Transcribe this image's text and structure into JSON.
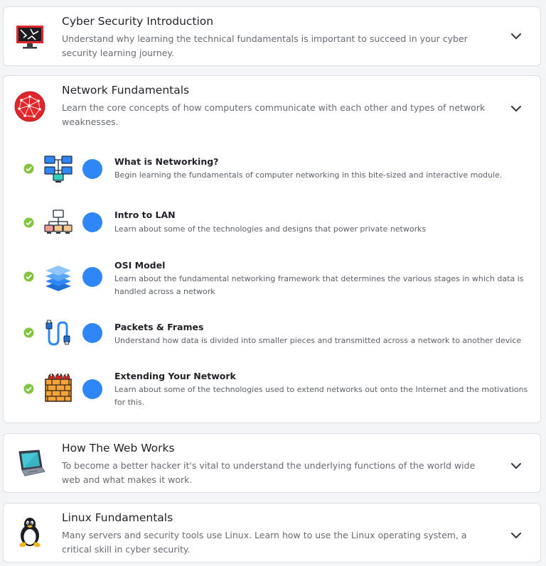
{
  "modules": [
    {
      "title": "Cyber Security Introduction",
      "description": "Understand why learning the technical fundamentals is important to succeed in your cyber security learning journey.",
      "icon": "monitor-hacked-icon",
      "expanded": false
    },
    {
      "title": "Network Fundamentals",
      "description": "Learn the core concepts of how computers communicate with each other and types of network weaknesses.",
      "icon": "network-globe-icon",
      "expanded": true,
      "rooms": [
        {
          "title": "What is Networking?",
          "description": "Begin learning the fundamentals of computer networking in this bite-sized and interactive module.",
          "icon": "networked-computers-icon",
          "completed": true
        },
        {
          "title": "Intro to LAN",
          "description": "Learn about some of the technologies and designs that power private networks",
          "icon": "lan-icon",
          "completed": true
        },
        {
          "title": "OSI Model",
          "description": "Learn about the fundamental networking framework that determines the various stages in which data is handled across a network",
          "icon": "layers-icon",
          "completed": true
        },
        {
          "title": "Packets & Frames",
          "description": "Understand how data is divided into smaller pieces and transmitted across a network to another device",
          "icon": "ethernet-cable-icon",
          "completed": true
        },
        {
          "title": "Extending Your Network",
          "description": "Learn about some of the technologies used to extend networks out onto the Internet and the motivations for this.",
          "icon": "firewall-icon",
          "completed": true
        }
      ]
    },
    {
      "title": "How The Web Works",
      "description": "To become a better hacker it's vital to understand the underlying functions of the world wide web and what makes it work.",
      "icon": "laptop-icon",
      "expanded": false
    },
    {
      "title": "Linux Fundamentals",
      "description": "Many servers and security tools use Linux. Learn how to use the Linux operating system, a critical skill in cyber security.",
      "icon": "linux-penguin-icon",
      "expanded": false
    }
  ],
  "colors": {
    "check_green": "#84c441",
    "progress_blue": "#2f86f6",
    "network_red": "#e0262b"
  }
}
